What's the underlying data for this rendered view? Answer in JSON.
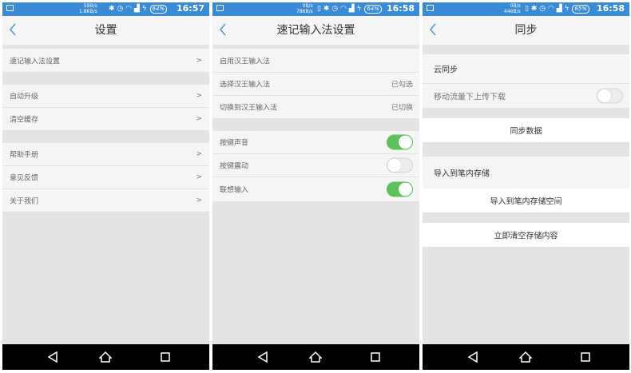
{
  "colors": {
    "accent": "#47a2c6",
    "statusbar": "#3a8bd6",
    "toggle_on": "#5fc15a",
    "background": "#e4e4e4",
    "row": "#f5f5f5"
  },
  "panels": [
    {
      "status": {
        "speed_up": "59B/s",
        "speed_down": "1.8KB/s",
        "battery": "64%",
        "time": "16:57"
      },
      "title": "设置",
      "rows": [
        {
          "label": "速记输入法设置",
          "arrow": ">"
        },
        {
          "label": "自动升级",
          "arrow": ">"
        },
        {
          "label": "清空缓存",
          "arrow": ">"
        },
        {
          "label": "帮助手册",
          "arrow": ">"
        },
        {
          "label": "意见反馈",
          "arrow": ">"
        },
        {
          "label": "关于我们",
          "arrow": ">"
        }
      ]
    },
    {
      "status": {
        "speed_up": "0B/s",
        "speed_down": "786B/s",
        "battery": "64%",
        "time": "16:58"
      },
      "title": "速记输入法设置",
      "rows": [
        {
          "label": "启用汉王输入法"
        },
        {
          "label": "选择汉王输入法",
          "status": "已勾选"
        },
        {
          "label": "切换到汉王输入法",
          "status": "已切换"
        },
        {
          "label": "按键声音",
          "toggle": true
        },
        {
          "label": "按键震动",
          "toggle": false
        },
        {
          "label": "联想输入",
          "toggle": true
        }
      ]
    },
    {
      "status": {
        "speed_up": "0B/s",
        "speed_down": "446B/s",
        "battery": "65%",
        "time": "16:58"
      },
      "title": "同步",
      "cloud_sync_header": "云同步",
      "mobile_data_label": "移动流量下上传下载",
      "mobile_data_toggle": false,
      "sync_button": "同步数据",
      "import_header": "导入到笔内存储",
      "import_button": "导入到笔内存储空间",
      "clear_button": "立即清空存储内容"
    }
  ],
  "icons": {
    "back": "chevron-left-icon",
    "nav_back": "triangle-back-icon",
    "nav_home": "home-icon",
    "nav_recent": "square-recent-icon"
  }
}
